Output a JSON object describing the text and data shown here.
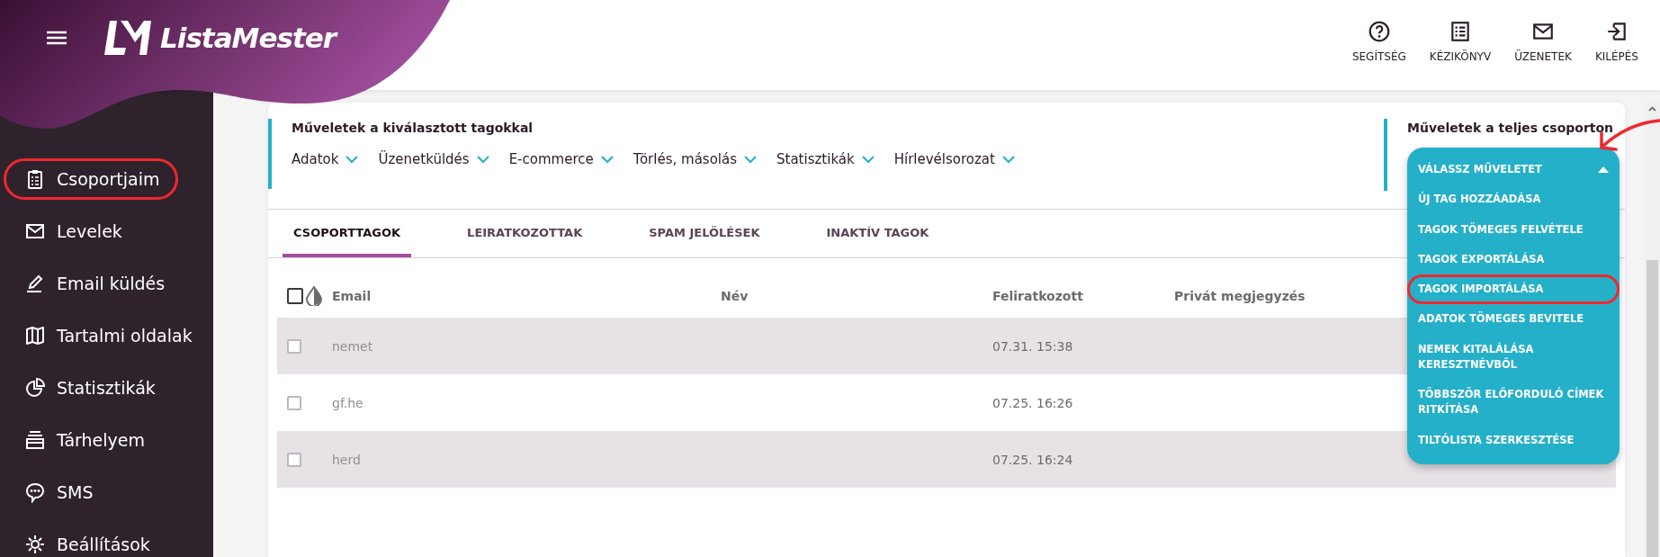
{
  "brand": {
    "name": "ListaMester"
  },
  "header_actions": [
    {
      "label": "SEGÍTSÉG"
    },
    {
      "label": "KÉZIKÖNYV"
    },
    {
      "label": "ÜZENETEK"
    },
    {
      "label": "KILÉPÉS"
    }
  ],
  "sidebar": {
    "items": [
      {
        "label": "Csoportjaim",
        "annotated": true
      },
      {
        "label": "Levelek",
        "annotated": false
      },
      {
        "label": "Email küldés",
        "annotated": false
      },
      {
        "label": "Tartalmi oldalak",
        "annotated": false
      },
      {
        "label": "Statisztikák",
        "annotated": false
      },
      {
        "label": "Tárhelyem",
        "annotated": false
      },
      {
        "label": "SMS",
        "annotated": false
      },
      {
        "label": "Beállítások",
        "annotated": false
      }
    ]
  },
  "selected_actions": {
    "title": "Műveletek a kiválasztott tagokkal",
    "menus": [
      "Adatok",
      "Üzenetküldés",
      "E-commerce",
      "Törlés, másolás",
      "Statisztikák",
      "Hírlevélsorozat"
    ]
  },
  "group_actions": {
    "title": "Műveletek a teljes csoporton",
    "dropdown": {
      "label": "VÁLASSZ MŰVELETET",
      "expanded": true,
      "annotated": true,
      "options": [
        {
          "label": "ÚJ TAG HOZZÁADÁSA",
          "annotated": false
        },
        {
          "label": "TAGOK TÖMEGES FELVÉTELE",
          "annotated": false
        },
        {
          "label": "TAGOK EXPORTÁLÁSA",
          "annotated": false
        },
        {
          "label": "TAGOK IMPORTÁLÁSA",
          "annotated": true
        },
        {
          "label": "ADATOK TÖMEGES BEVITELE",
          "annotated": false
        },
        {
          "label": "NEMEK KITALÁLÁSA KERESZTNÉVBŐL",
          "annotated": false
        },
        {
          "label": "TÖBBSZÖR ELŐFORDULÓ CÍMEK RITKÍTÁSA",
          "annotated": false
        },
        {
          "label": "TILTÓLISTA SZERKESZTÉSE",
          "annotated": false
        }
      ]
    }
  },
  "tabs": [
    {
      "label": "CSOPORTTAGOK",
      "selected": true
    },
    {
      "label": "LEIRATKOZOTTAK",
      "selected": false
    },
    {
      "label": "SPAM JELÖLÉSEK",
      "selected": false
    },
    {
      "label": "INAKTÍV TAGOK",
      "selected": false
    }
  ],
  "table": {
    "select_all_checked": false,
    "columns": [
      "Email",
      "Név",
      "Feliratkozott",
      "Privát megjegyzés"
    ],
    "rows": [
      {
        "checked": false,
        "email": "nemet",
        "subscribed": "07.31. 15:38"
      },
      {
        "checked": false,
        "email": "gf.he",
        "subscribed": "07.25. 16:26"
      },
      {
        "checked": false,
        "email": "herd",
        "subscribed": "07.25. 16:24"
      }
    ]
  }
}
